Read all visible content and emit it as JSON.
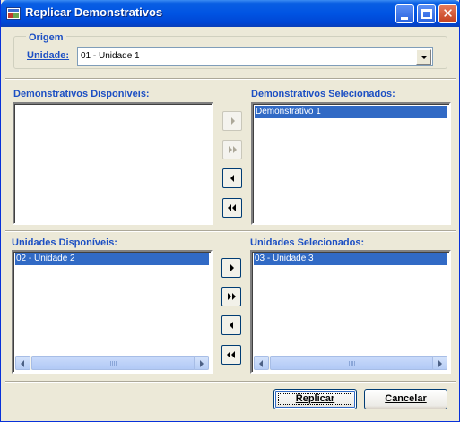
{
  "window": {
    "title": "Replicar Demonstrativos"
  },
  "titlebar_buttons": {
    "minimize": "minimize-icon",
    "maximize": "maximize-icon",
    "close": "close-icon"
  },
  "origem": {
    "legend": "Origem",
    "unidade_label": "Unidade:",
    "unidade_value": "01 - Unidade 1"
  },
  "demonstrativos": {
    "disponiveis_label": "Demonstrativos Disponíveis:",
    "disponiveis_items": [],
    "selecionados_label": "Demonstrativos Selecionados:",
    "selecionados_items": [
      "Demonstrativo 1"
    ]
  },
  "unidades": {
    "disponiveis_label": "Unidades Disponíveis:",
    "disponiveis_items": [
      "02 - Unidade 2"
    ],
    "selecionados_label": "Unidades Selecionados:",
    "selecionados_items": [
      "03 - Unidade 3"
    ]
  },
  "actions": {
    "replicar": "Replicar",
    "cancelar": "Cancelar"
  },
  "colors": {
    "accent": "#1c4fc3",
    "selection": "#316ac5",
    "titlebar": "#0054e3"
  }
}
